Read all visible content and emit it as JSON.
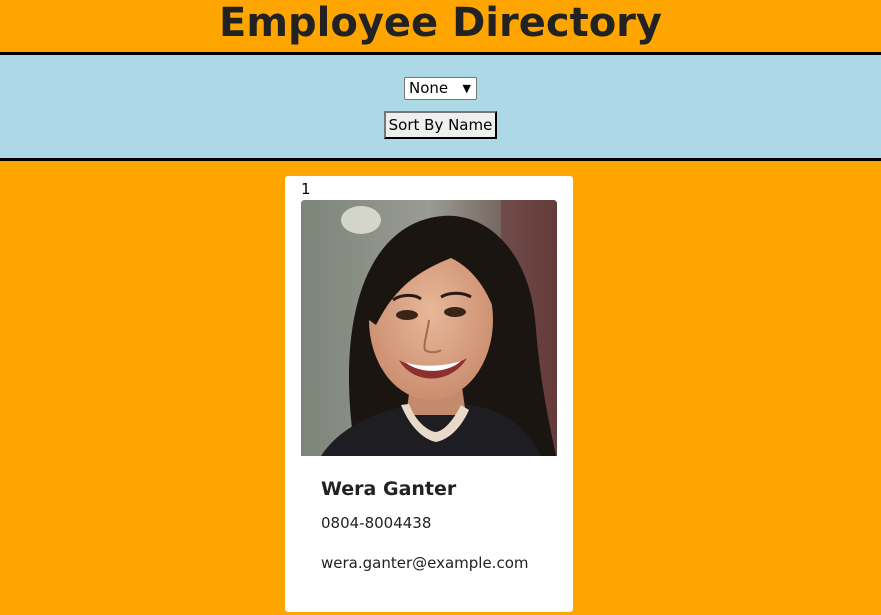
{
  "header": {
    "title": "Employee Directory"
  },
  "controls": {
    "filter_selected": "None",
    "sort_button_label": "Sort By Name"
  },
  "employees": [
    {
      "index": "1",
      "name": "Wera Ganter",
      "phone": "0804-8004438",
      "email": "wera.ganter@example.com"
    }
  ],
  "colors": {
    "page_bg": "#FFA500",
    "controls_bg": "#ADD8E6",
    "card_bg": "#FFFFFF"
  }
}
